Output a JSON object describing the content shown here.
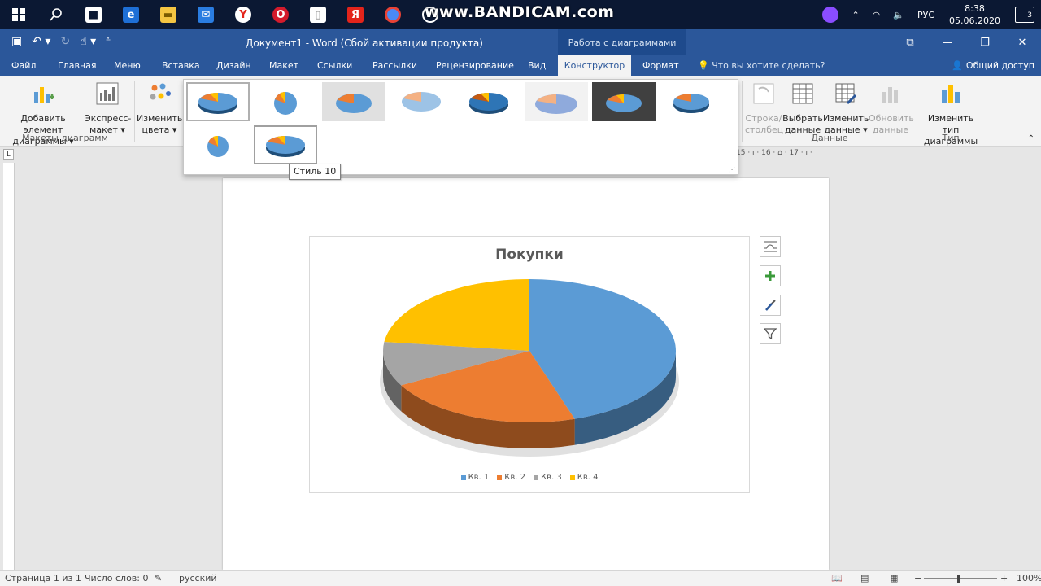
{
  "taskbar": {
    "watermark": "www.BANDICAM.com",
    "language": "РУС",
    "time": "8:38",
    "date": "05.06.2020",
    "notifications": "3"
  },
  "titlebar": {
    "doc_title": "Документ1 - Word (Сбой активации продукта)",
    "context_title": "Работа с диаграммами"
  },
  "tabs": {
    "file": "Файл",
    "home": "Главная",
    "menu": "Меню",
    "insert": "Вставка",
    "design": "Дизайн",
    "layout": "Макет",
    "references": "Ссылки",
    "mailings": "Рассылки",
    "review": "Рецензирование",
    "view": "Вид",
    "constructor": "Конструктор",
    "format": "Формат",
    "search": "Что вы хотите сделать?",
    "share": "Общий доступ"
  },
  "ribbon": {
    "add_element": "Добавить элемент",
    "add_element2": "диаграммы",
    "express": "Экспресс-",
    "express2": "макет",
    "change_colors": "Изменить",
    "change_colors2": "цвета",
    "group_layouts": "Макеты диаграмм",
    "row_col": "Строка/",
    "row_col2": "столбец",
    "select_data": "Выбрать",
    "select_data2": "данные",
    "edit_data": "Изменить",
    "edit_data2": "данные",
    "refresh_data": "Обновить",
    "refresh_data2": "данные",
    "group_data": "Данные",
    "change_type": "Изменить тип",
    "change_type2": "диаграммы",
    "group_type": "Тип"
  },
  "gallery": {
    "tooltip": "Стиль 10"
  },
  "ruler": {
    "marks": "15 · ı · 16 · ⌂ · 17 · ı ·"
  },
  "chart_data": {
    "type": "pie",
    "title": "Покупки",
    "categories": [
      "Кв. 1",
      "Кв. 2",
      "Кв. 3",
      "Кв. 4"
    ],
    "values": [
      45,
      22,
      10,
      23
    ],
    "colors": [
      "#5b9bd5",
      "#ed7d31",
      "#a5a5a5",
      "#ffc000"
    ],
    "legend_position": "bottom",
    "style": "3d"
  },
  "statusbar": {
    "page": "Страница 1 из 1",
    "words": "Число слов: 0",
    "language": "русский",
    "zoom": "100%"
  }
}
